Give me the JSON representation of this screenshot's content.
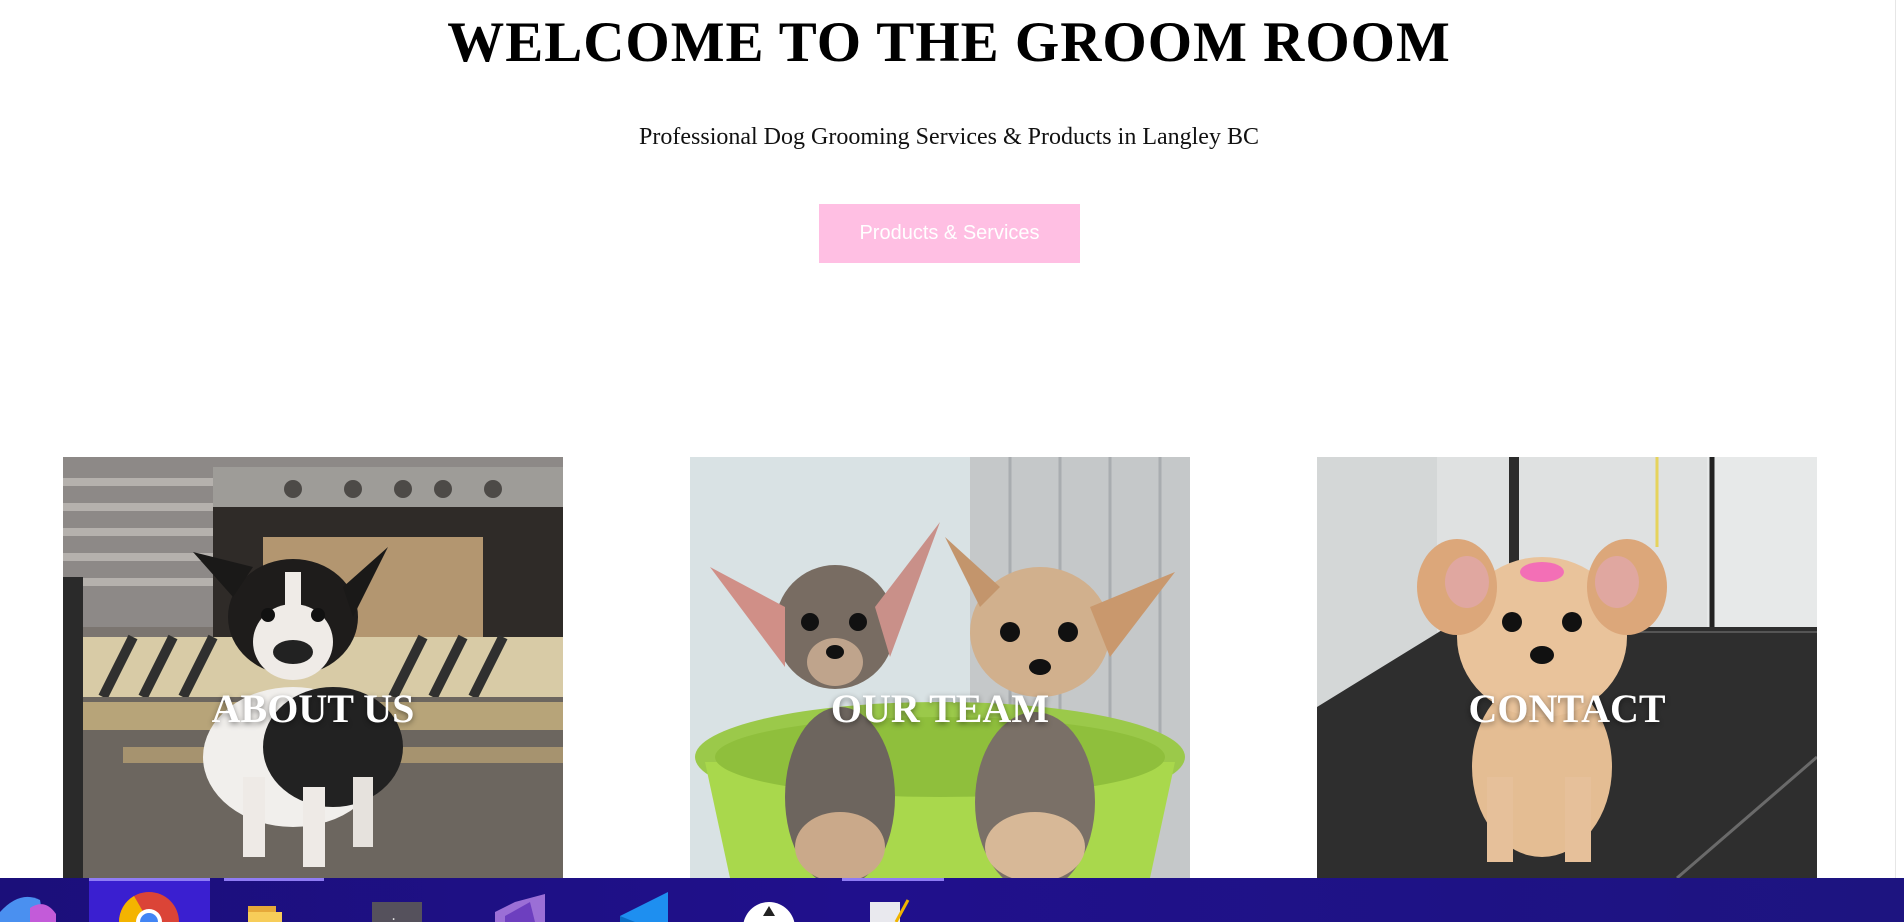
{
  "hero": {
    "title": "WELCOME TO THE GROOM ROOM",
    "subtitle": "Professional Dog Grooming Services & Products in Langley BC",
    "cta_label": "Products & Services"
  },
  "cards": [
    {
      "label": "ABOUT US"
    },
    {
      "label": "OUR TEAM"
    },
    {
      "label": "CONTACT"
    }
  ],
  "colors": {
    "cta_background": "#ffbfe3",
    "taskbar": "#20108c",
    "taskbar_active_indicator": "#8f7cf5"
  },
  "taskbar": {
    "apps": [
      {
        "icon": "copilot-icon"
      },
      {
        "icon": "chrome-icon",
        "active": true
      },
      {
        "icon": "file-explorer-icon"
      },
      {
        "icon": "terminal-icon"
      },
      {
        "icon": "visual-studio-icon"
      },
      {
        "icon": "vscode-icon"
      },
      {
        "icon": "inkscape-icon"
      },
      {
        "icon": "notepad-icon"
      }
    ]
  }
}
